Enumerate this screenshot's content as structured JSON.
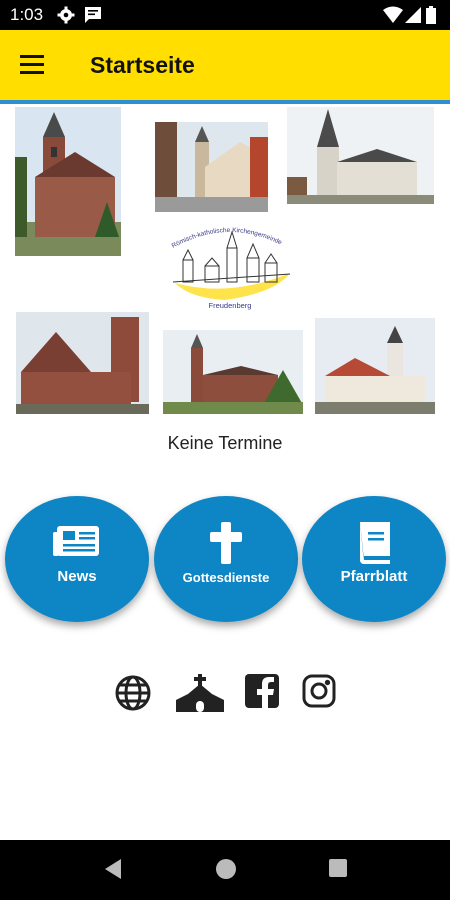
{
  "status_bar": {
    "time": "1:03"
  },
  "app_bar": {
    "title": "Startseite"
  },
  "logo": {
    "arc_text": "Römisch-katholische Kirchengemeinde",
    "town_text": "Freudenberg"
  },
  "events": {
    "empty_text": "Keine Termine"
  },
  "quick_links": [
    {
      "label": "News",
      "icon": "newspaper-icon"
    },
    {
      "label": "Gottesdienste",
      "icon": "cross-icon"
    },
    {
      "label": "Pfarrblatt",
      "icon": "book-icon"
    }
  ],
  "social_links": [
    "globe-icon",
    "church-icon",
    "facebook-icon",
    "instagram-icon"
  ],
  "colors": {
    "app_bar": "#FFDE00",
    "accent": "#2E8FD3",
    "button": "#0E86C5"
  }
}
